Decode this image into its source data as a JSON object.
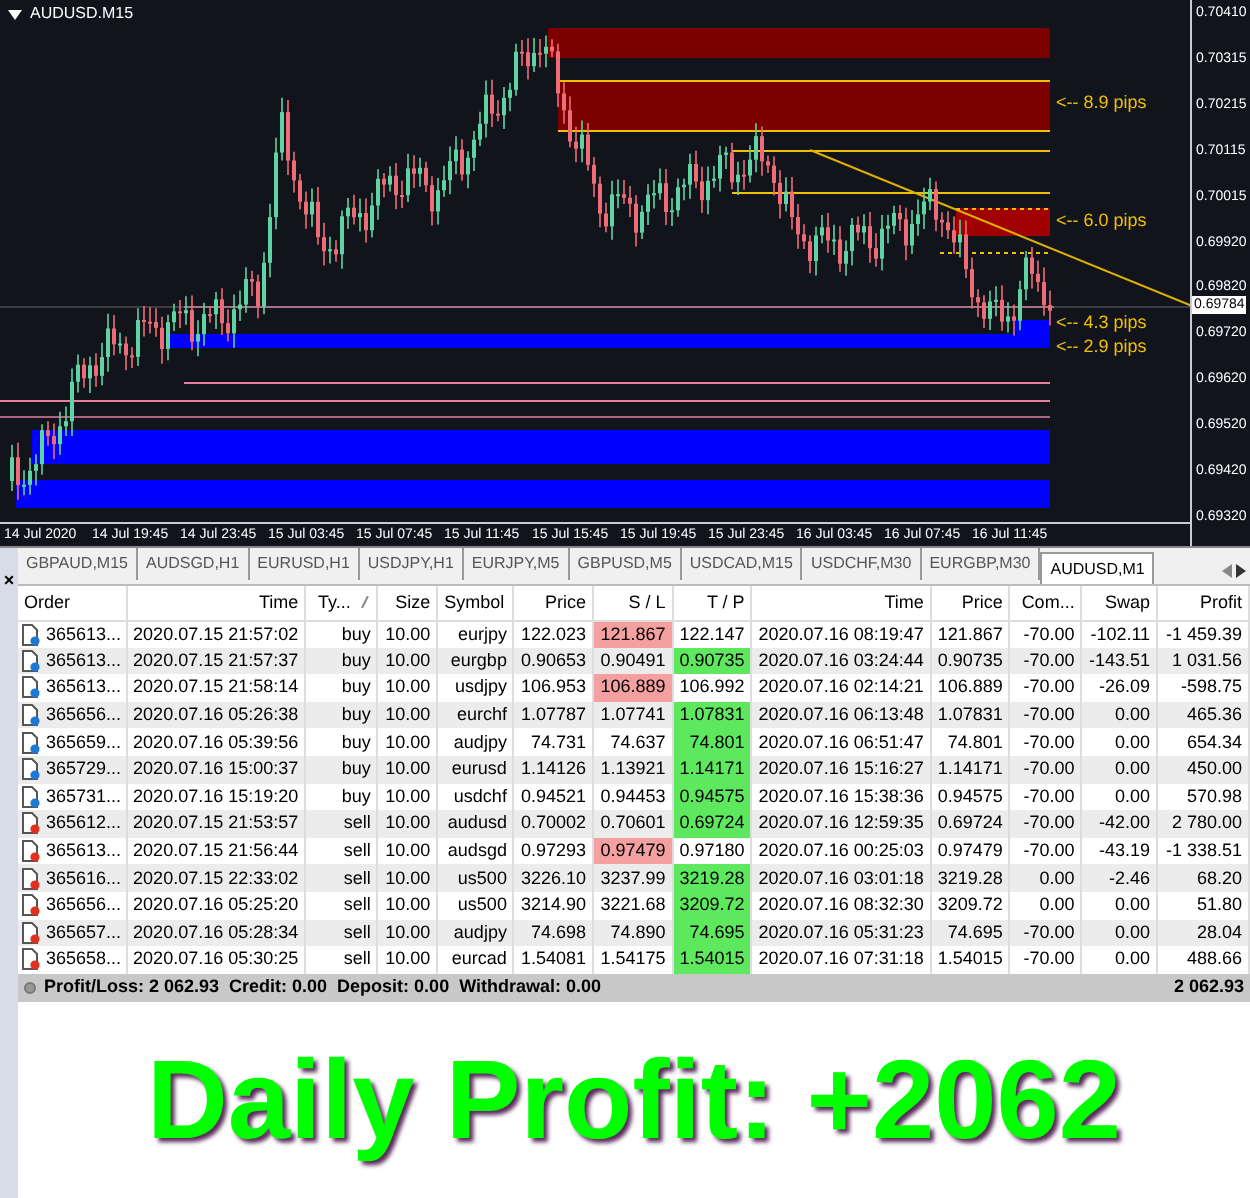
{
  "chart": {
    "title": "AUDUSD.M15",
    "price_axis": [
      "0.70410",
      "0.70315",
      "0.70215",
      "0.70115",
      "0.70015",
      "0.69920",
      "0.69820",
      "0.69720",
      "0.69620",
      "0.69520",
      "0.69420",
      "0.69320"
    ],
    "time_axis": [
      "14 Jul 2020",
      "14 Jul 19:45",
      "14 Jul 23:45",
      "15 Jul 03:45",
      "15 Jul 07:45",
      "15 Jul 11:45",
      "15 Jul 15:45",
      "15 Jul 19:45",
      "15 Jul 23:45",
      "16 Jul 03:45",
      "16 Jul 07:45",
      "16 Jul 11:45"
    ],
    "current_price": "0.69784",
    "pip_labels": [
      "<-- 8.9 pips",
      "<-- 6.0 pips",
      "<-- 4.3 pips",
      "<-- 2.9 pips"
    ]
  },
  "close_button": "×",
  "tabs": [
    {
      "label": "GBPAUD,M15",
      "selected": false
    },
    {
      "label": "AUDSGD,H1",
      "selected": false
    },
    {
      "label": "EURUSD,H1",
      "selected": false
    },
    {
      "label": "USDJPY,H1",
      "selected": false
    },
    {
      "label": "EURJPY,M5",
      "selected": false
    },
    {
      "label": "GBPUSD,M5",
      "selected": false
    },
    {
      "label": "USDCAD,M15",
      "selected": false
    },
    {
      "label": "USDCHF,M30",
      "selected": false
    },
    {
      "label": "EURGBP,M30",
      "selected": false
    },
    {
      "label": "AUDUSD,M1",
      "selected": true
    }
  ],
  "table": {
    "columns": [
      "Order",
      "Time",
      "Ty...",
      "Size",
      "Symbol",
      "Price",
      "S / L",
      "T / P",
      "Time",
      "Price",
      "Com...",
      "Swap",
      "Profit"
    ],
    "rows": [
      {
        "kind": "buy",
        "order": "365613...",
        "time": "2020.07.15 21:57:02",
        "type": "buy",
        "size": "10.00",
        "symbol": "eurjpy",
        "price": "122.023",
        "sl": "121.867",
        "tp": "122.147",
        "close_time": "2020.07.16 08:19:47",
        "close_price": "121.867",
        "commission": "-70.00",
        "swap": "-102.11",
        "profit": "-1 459.39",
        "sl_hit": true,
        "tp_hit": false
      },
      {
        "kind": "buy",
        "order": "365613...",
        "time": "2020.07.15 21:57:37",
        "type": "buy",
        "size": "10.00",
        "symbol": "eurgbp",
        "price": "0.90653",
        "sl": "0.90491",
        "tp": "0.90735",
        "close_time": "2020.07.16 03:24:44",
        "close_price": "0.90735",
        "commission": "-70.00",
        "swap": "-143.51",
        "profit": "1 031.56",
        "sl_hit": false,
        "tp_hit": true
      },
      {
        "kind": "buy",
        "order": "365613...",
        "time": "2020.07.15 21:58:14",
        "type": "buy",
        "size": "10.00",
        "symbol": "usdjpy",
        "price": "106.953",
        "sl": "106.889",
        "tp": "106.992",
        "close_time": "2020.07.16 02:14:21",
        "close_price": "106.889",
        "commission": "-70.00",
        "swap": "-26.09",
        "profit": "-598.75",
        "sl_hit": true,
        "tp_hit": false
      },
      {
        "kind": "buy",
        "order": "365656...",
        "time": "2020.07.16 05:26:38",
        "type": "buy",
        "size": "10.00",
        "symbol": "eurchf",
        "price": "1.07787",
        "sl": "1.07741",
        "tp": "1.07831",
        "close_time": "2020.07.16 06:13:48",
        "close_price": "1.07831",
        "commission": "-70.00",
        "swap": "0.00",
        "profit": "465.36",
        "sl_hit": false,
        "tp_hit": true
      },
      {
        "kind": "buy",
        "order": "365659...",
        "time": "2020.07.16 05:39:56",
        "type": "buy",
        "size": "10.00",
        "symbol": "audjpy",
        "price": "74.731",
        "sl": "74.637",
        "tp": "74.801",
        "close_time": "2020.07.16 06:51:47",
        "close_price": "74.801",
        "commission": "-70.00",
        "swap": "0.00",
        "profit": "654.34",
        "sl_hit": false,
        "tp_hit": true
      },
      {
        "kind": "buy",
        "order": "365729...",
        "time": "2020.07.16 15:00:37",
        "type": "buy",
        "size": "10.00",
        "symbol": "eurusd",
        "price": "1.14126",
        "sl": "1.13921",
        "tp": "1.14171",
        "close_time": "2020.07.16 15:16:27",
        "close_price": "1.14171",
        "commission": "-70.00",
        "swap": "0.00",
        "profit": "450.00",
        "sl_hit": false,
        "tp_hit": true
      },
      {
        "kind": "buy",
        "order": "365731...",
        "time": "2020.07.16 15:19:20",
        "type": "buy",
        "size": "10.00",
        "symbol": "usdchf",
        "price": "0.94521",
        "sl": "0.94453",
        "tp": "0.94575",
        "close_time": "2020.07.16 15:38:36",
        "close_price": "0.94575",
        "commission": "-70.00",
        "swap": "0.00",
        "profit": "570.98",
        "sl_hit": false,
        "tp_hit": true
      },
      {
        "kind": "sell",
        "order": "365612...",
        "time": "2020.07.15 21:53:57",
        "type": "sell",
        "size": "10.00",
        "symbol": "audusd",
        "price": "0.70002",
        "sl": "0.70601",
        "tp": "0.69724",
        "close_time": "2020.07.16 12:59:35",
        "close_price": "0.69724",
        "commission": "-70.00",
        "swap": "-42.00",
        "profit": "2 780.00",
        "sl_hit": false,
        "tp_hit": true
      },
      {
        "kind": "sell",
        "order": "365613...",
        "time": "2020.07.15 21:56:44",
        "type": "sell",
        "size": "10.00",
        "symbol": "audsgd",
        "price": "0.97293",
        "sl": "0.97479",
        "tp": "0.97180",
        "close_time": "2020.07.16 00:25:03",
        "close_price": "0.97479",
        "commission": "-70.00",
        "swap": "-43.19",
        "profit": "-1 338.51",
        "sl_hit": true,
        "tp_hit": false
      },
      {
        "kind": "sell",
        "order": "365616...",
        "time": "2020.07.15 22:33:02",
        "type": "sell",
        "size": "10.00",
        "symbol": "us500",
        "price": "3226.10",
        "sl": "3237.99",
        "tp": "3219.28",
        "close_time": "2020.07.16 03:01:18",
        "close_price": "3219.28",
        "commission": "0.00",
        "swap": "-2.46",
        "profit": "68.20",
        "sl_hit": false,
        "tp_hit": true
      },
      {
        "kind": "sell",
        "order": "365656...",
        "time": "2020.07.16 05:25:20",
        "type": "sell",
        "size": "10.00",
        "symbol": "us500",
        "price": "3214.90",
        "sl": "3221.68",
        "tp": "3209.72",
        "close_time": "2020.07.16 08:32:30",
        "close_price": "3209.72",
        "commission": "0.00",
        "swap": "0.00",
        "profit": "51.80",
        "sl_hit": false,
        "tp_hit": true
      },
      {
        "kind": "sell",
        "order": "365657...",
        "time": "2020.07.16 05:28:34",
        "type": "sell",
        "size": "10.00",
        "symbol": "audjpy",
        "price": "74.698",
        "sl": "74.890",
        "tp": "74.695",
        "close_time": "2020.07.16 05:31:23",
        "close_price": "74.695",
        "commission": "-70.00",
        "swap": "0.00",
        "profit": "28.04",
        "sl_hit": false,
        "tp_hit": true
      },
      {
        "kind": "sell",
        "order": "365658...",
        "time": "2020.07.16 05:30:25",
        "type": "sell",
        "size": "10.00",
        "symbol": "eurcad",
        "price": "1.54081",
        "sl": "1.54175",
        "tp": "1.54015",
        "close_time": "2020.07.16 07:31:18",
        "close_price": "1.54015",
        "commission": "-70.00",
        "swap": "0.00",
        "profit": "488.66",
        "sl_hit": false,
        "tp_hit": true
      }
    ]
  },
  "footer": {
    "summary": "Profit/Loss: 2 062.93  Credit: 0.00  Deposit: 0.00  Withdrawal: 0.00",
    "total": "2 062.93"
  },
  "banner": "Daily Profit: +2062"
}
